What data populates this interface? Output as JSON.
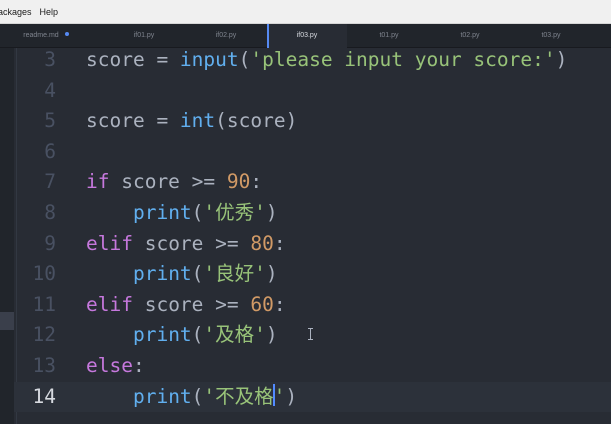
{
  "menubar": {
    "items": [
      "ackages",
      "Help"
    ]
  },
  "tabs": [
    {
      "label": "readme.md",
      "modified": true,
      "active": false
    },
    {
      "label": "if01.py",
      "active": false
    },
    {
      "label": "if02.py",
      "active": false
    },
    {
      "label": "if03.py",
      "active": true
    },
    {
      "label": "t01.py",
      "active": false
    },
    {
      "label": "t02.py",
      "active": false
    },
    {
      "label": "t03.py",
      "active": false
    }
  ],
  "editor": {
    "language": "python",
    "theme_colors": {
      "background": "#282c34",
      "keyword": "#c678dd",
      "function": "#61afef",
      "string": "#98c379",
      "number": "#d19a66",
      "text": "#abb2bf",
      "cursor": "#528bff"
    },
    "current_line": 14,
    "lines": [
      {
        "n": "3",
        "indent": "",
        "t": [
          [
            "",
            "score = "
          ],
          [
            "fn",
            "input"
          ],
          [
            "",
            "("
          ],
          [
            "str",
            "'please input your score:'"
          ],
          [
            "",
            ")"
          ]
        ]
      },
      {
        "n": "4",
        "indent": "",
        "t": []
      },
      {
        "n": "5",
        "indent": "",
        "t": [
          [
            "",
            "score = "
          ],
          [
            "fn",
            "int"
          ],
          [
            "",
            "(score)"
          ]
        ]
      },
      {
        "n": "6",
        "indent": "",
        "t": []
      },
      {
        "n": "7",
        "indent": "",
        "t": [
          [
            "kw",
            "if"
          ],
          [
            "",
            " score >= "
          ],
          [
            "num",
            "90"
          ],
          [
            "",
            ":"
          ]
        ]
      },
      {
        "n": "8",
        "indent": "    ",
        "t": [
          [
            "fn",
            "print"
          ],
          [
            "",
            "("
          ],
          [
            "str",
            "'优秀'"
          ],
          [
            "",
            ")"
          ]
        ]
      },
      {
        "n": "9",
        "indent": "",
        "t": [
          [
            "kw",
            "elif"
          ],
          [
            "",
            " score >= "
          ],
          [
            "num",
            "80"
          ],
          [
            "",
            ":"
          ]
        ]
      },
      {
        "n": "10",
        "indent": "    ",
        "t": [
          [
            "fn",
            "print"
          ],
          [
            "",
            "("
          ],
          [
            "str",
            "'良好'"
          ],
          [
            "",
            ")"
          ]
        ]
      },
      {
        "n": "11",
        "indent": "",
        "t": [
          [
            "kw",
            "elif"
          ],
          [
            "",
            " score >= "
          ],
          [
            "num",
            "60"
          ],
          [
            "",
            ":"
          ]
        ]
      },
      {
        "n": "12",
        "indent": "    ",
        "t": [
          [
            "fn",
            "print"
          ],
          [
            "",
            "("
          ],
          [
            "str",
            "'及格'"
          ],
          [
            "",
            ")"
          ]
        ]
      },
      {
        "n": "13",
        "indent": "",
        "t": [
          [
            "kw",
            "else"
          ],
          [
            "",
            ":"
          ]
        ]
      },
      {
        "n": "14",
        "indent": "    ",
        "t": [
          [
            "fn",
            "print"
          ],
          [
            "",
            "("
          ],
          [
            "str",
            "'不及格"
          ],
          [
            "cursor",
            ""
          ],
          [
            "str",
            "'"
          ],
          [
            "",
            ")"
          ]
        ]
      }
    ]
  }
}
